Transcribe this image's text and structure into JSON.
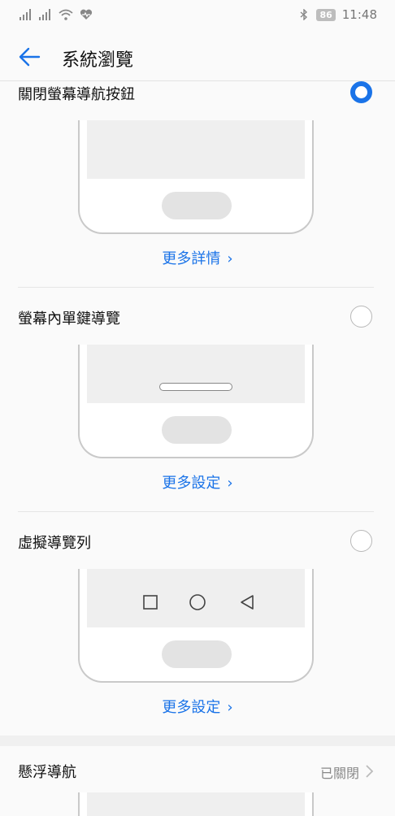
{
  "status_bar": {
    "battery": "86",
    "time": "11:48"
  },
  "header": {
    "title": "系統瀏覽"
  },
  "options": [
    {
      "title": "關閉螢幕導航按鈕",
      "selected": true,
      "link": "更多詳情"
    },
    {
      "title": "螢幕內單鍵導覽",
      "selected": false,
      "link": "更多設定"
    },
    {
      "title": "虛擬導覽列",
      "selected": false,
      "link": "更多設定"
    }
  ],
  "floating_nav": {
    "title": "懸浮導航",
    "value": "已關閉"
  },
  "colors": {
    "accent": "#1a73e8",
    "background": "#fafafa"
  }
}
